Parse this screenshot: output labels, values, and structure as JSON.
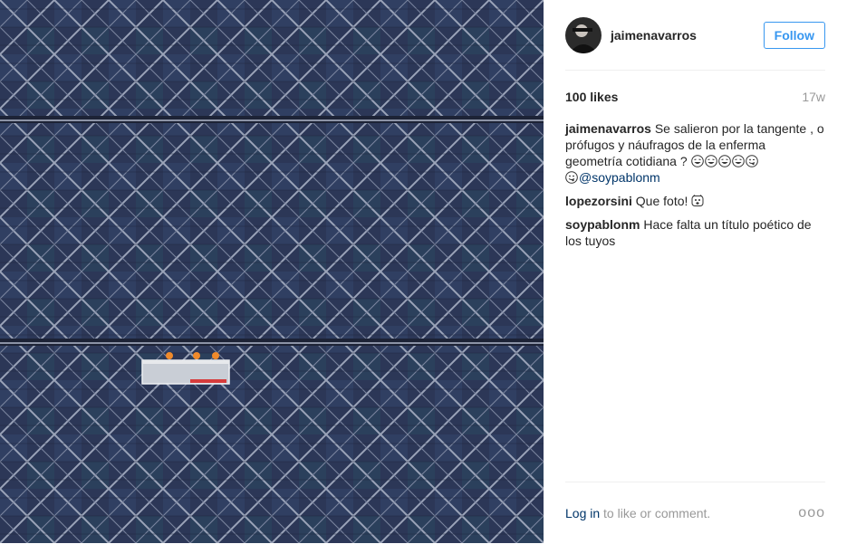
{
  "post": {
    "username": "jaimenavarros",
    "follow_label": "Follow",
    "likes": "100 likes",
    "age": "17w"
  },
  "comments": [
    {
      "user": "jaimenavarros",
      "text": "Se salieron por la tangente , o prófugos y náufragos de la enferma geometría cotidiana ?",
      "emoji_after": [
        "laughing-emoji",
        "laughing-emoji",
        "laughing-emoji",
        "laughing-emoji",
        "winking-tongue-emoji",
        "winking-tongue-emoji"
      ],
      "mention": "@soypablonm"
    },
    {
      "user": "lopezorsini",
      "text": "Que foto!",
      "emoji_after": [
        "face-emoji"
      ]
    },
    {
      "user": "soypablonm",
      "text": "Hace falta un título poético de los tuyos"
    }
  ],
  "footer": {
    "login_link": "Log in",
    "login_suffix": " to like or comment.",
    "more_label": "ooo"
  },
  "colors": {
    "link_blue": "#3897f0",
    "mention_navy": "#003569",
    "glass_blue": "#27314f"
  }
}
